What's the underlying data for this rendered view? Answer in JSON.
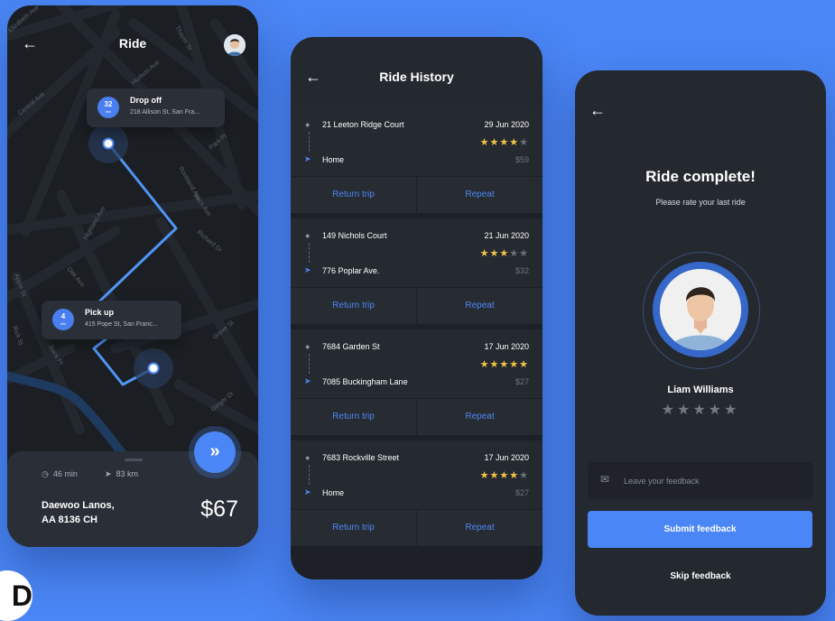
{
  "map_screen": {
    "title": "Ride",
    "back_icon": "arrow-left-icon",
    "streets": [
      "Elizabeth Ave",
      "Central Ave",
      "Hudson Ave",
      "Thayer St",
      "Park Pl",
      "Rockland Ave",
      "Richard Dr",
      "Highland Ave",
      "Oak Ave",
      "Birch Ave",
      "Apple St",
      "Grove St",
      "Ginger Dr",
      "Back Pl",
      "Rick St"
    ],
    "dropoff": {
      "minutes": "32",
      "unit": "min",
      "label": "Drop off",
      "address": "218 Allison St, San Fra..."
    },
    "pickup": {
      "minutes": "4",
      "unit": "min",
      "label": "Pick up",
      "address": "415 Pope St, San Franc..."
    },
    "duration": "46 min",
    "distance": "83 km",
    "car_line1": "Daewoo Lanos,",
    "car_line2": "AA 8136 CH",
    "price": "$67",
    "go_icon": "double-chevron-right-icon"
  },
  "history_screen": {
    "title": "Ride History",
    "trips": [
      {
        "from": "21 Leeton Ridge Court",
        "to": "Home",
        "date": "29 Jun 2020",
        "cost": "$59",
        "rating": 3.5,
        "stars": [
          "on",
          "on",
          "on",
          "half",
          "off"
        ],
        "return_label": "Return trip",
        "repeat_label": "Repeat"
      },
      {
        "from": "149 Nichols Court",
        "to": "776 Poplar Ave.",
        "date": "21 Jun 2020",
        "cost": "$32",
        "rating": 3,
        "stars": [
          "on",
          "on",
          "on",
          "off",
          "off"
        ],
        "return_label": "Return trip",
        "repeat_label": "Repeat"
      },
      {
        "from": "7684 Garden St",
        "to": "7085 Buckingham Lane",
        "date": "17 Jun 2020",
        "cost": "$27",
        "rating": 5,
        "stars": [
          "on",
          "on",
          "on",
          "on",
          "on"
        ],
        "return_label": "Return trip",
        "repeat_label": "Repeat"
      },
      {
        "from": "7683 Rockville Street",
        "to": "Home",
        "date": "17 Jun 2020",
        "cost": "$27",
        "rating": 3.5,
        "stars": [
          "on",
          "on",
          "on",
          "half",
          "off"
        ],
        "return_label": "Return trip",
        "repeat_label": "Repeat"
      }
    ]
  },
  "rate_screen": {
    "title": "Ride complete!",
    "subtitle": "Please rate your last ride",
    "driver_name": "Liam Williams",
    "rating": 0,
    "feedback_placeholder": "Leave your feedback",
    "feedback_value": "",
    "submit_label": "Submit feedback",
    "skip_label": "Skip feedback"
  },
  "colors": {
    "background": "#4a86f5",
    "card": "#24282f",
    "accent": "#4f86f4",
    "star": "#f4c447"
  }
}
